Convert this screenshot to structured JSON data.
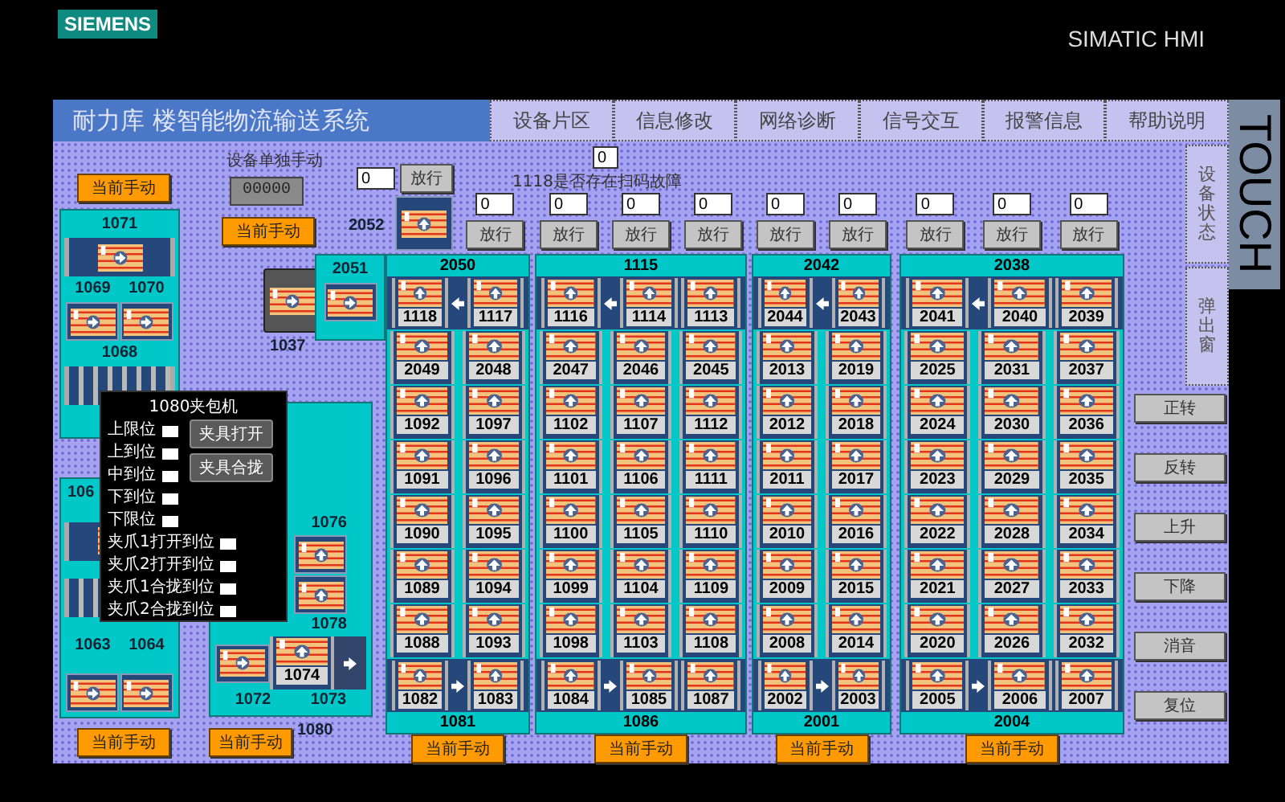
{
  "header": {
    "logo": "SIEMENS",
    "product": "SIMATIC HMI"
  },
  "title": "耐力库 楼智能物流输送系统",
  "nav_buttons": [
    "设备片区",
    "信息修改",
    "网络诊断",
    "信号交互",
    "报警信息",
    "帮助说明"
  ],
  "touch_label": "TOUCH",
  "side_tabs": [
    "设备状态",
    "弹出窗"
  ],
  "control_buttons": [
    "正转",
    "反转",
    "上升",
    "下降",
    "消音",
    "复位"
  ],
  "left_area": {
    "top_button": "当前手动",
    "manual_label": "设备单独手动",
    "manual_display": "00000",
    "manual_button": "当前手动",
    "bottom_buttons": [
      "当前手动",
      "当前手动"
    ],
    "stations": [
      "1071",
      "1069",
      "1070",
      "1068",
      "106",
      "1063",
      "1064",
      "1076",
      "1078",
      "1074",
      "1072",
      "1073",
      "1080",
      "1037",
      "2051",
      "2052"
    ],
    "gate_2052": {
      "value": "0",
      "button": "放行"
    }
  },
  "scan_fault": {
    "label": "1118是否存在扫码故障",
    "value": "0"
  },
  "groups": [
    {
      "header": "2050",
      "gates": [
        {
          "value": "0",
          "button": "放行"
        }
      ],
      "top_row": [
        "1118",
        "1117"
      ],
      "rows": [
        [
          "2049",
          "2048"
        ],
        [
          "1092",
          "1097"
        ],
        [
          "1091",
          "1096"
        ],
        [
          "1090",
          "1095"
        ],
        [
          "1089",
          "1094"
        ],
        [
          "1088",
          "1093"
        ]
      ],
      "bottom_row": [
        "1082",
        "1083"
      ],
      "footer": "1081",
      "mode_button": "当前手动"
    },
    {
      "header": "1115",
      "gates": [
        {
          "value": "0",
          "button": "放行"
        },
        {
          "value": "0",
          "button": "放行"
        },
        {
          "value": "0",
          "button": "放行"
        }
      ],
      "top_row": [
        "1116",
        "1114",
        "1113"
      ],
      "rows": [
        [
          "2047",
          "2046",
          "2045"
        ],
        [
          "1102",
          "1107",
          "1112"
        ],
        [
          "1101",
          "1106",
          "1111"
        ],
        [
          "1100",
          "1105",
          "1110"
        ],
        [
          "1099",
          "1104",
          "1109"
        ],
        [
          "1098",
          "1103",
          "1108"
        ]
      ],
      "bottom_row": [
        "1084",
        "1085",
        "1087"
      ],
      "footer": "1086",
      "mode_button": "当前手动"
    },
    {
      "header": "2042",
      "gates": [
        {
          "value": "0",
          "button": "放行"
        },
        {
          "value": "0",
          "button": "放行"
        }
      ],
      "top_row": [
        "2044",
        "2043"
      ],
      "rows": [
        [
          "2013",
          "2019"
        ],
        [
          "2012",
          "2018"
        ],
        [
          "2011",
          "2017"
        ],
        [
          "2010",
          "2016"
        ],
        [
          "2009",
          "2015"
        ],
        [
          "2008",
          "2014"
        ]
      ],
      "bottom_row": [
        "2002",
        "2003"
      ],
      "footer": "2001",
      "mode_button": "当前手动"
    },
    {
      "header": "2038",
      "gates": [
        {
          "value": "0",
          "button": "放行"
        },
        {
          "value": "0",
          "button": "放行"
        },
        {
          "value": "0",
          "button": "放行"
        }
      ],
      "top_row": [
        "2041",
        "2040",
        "2039"
      ],
      "rows": [
        [
          "2025",
          "2031",
          "2037"
        ],
        [
          "2024",
          "2030",
          "2036"
        ],
        [
          "2023",
          "2029",
          "2035"
        ],
        [
          "2022",
          "2028",
          "2034"
        ],
        [
          "2021",
          "2027",
          "2033"
        ],
        [
          "2020",
          "2026",
          "2032"
        ]
      ],
      "bottom_row": [
        "2005",
        "2006",
        "2007"
      ],
      "footer": "2004",
      "mode_button": "当前手动"
    }
  ],
  "popup": {
    "title": "1080夹包机",
    "signals": [
      "上限位",
      "上到位",
      "中到位",
      "下到位",
      "下限位",
      "夹爪1打开到位",
      "夹爪2打开到位",
      "夹爪1合拢到位",
      "夹爪2合拢到位"
    ],
    "buttons": [
      "夹具打开",
      "夹具合拢"
    ]
  }
}
